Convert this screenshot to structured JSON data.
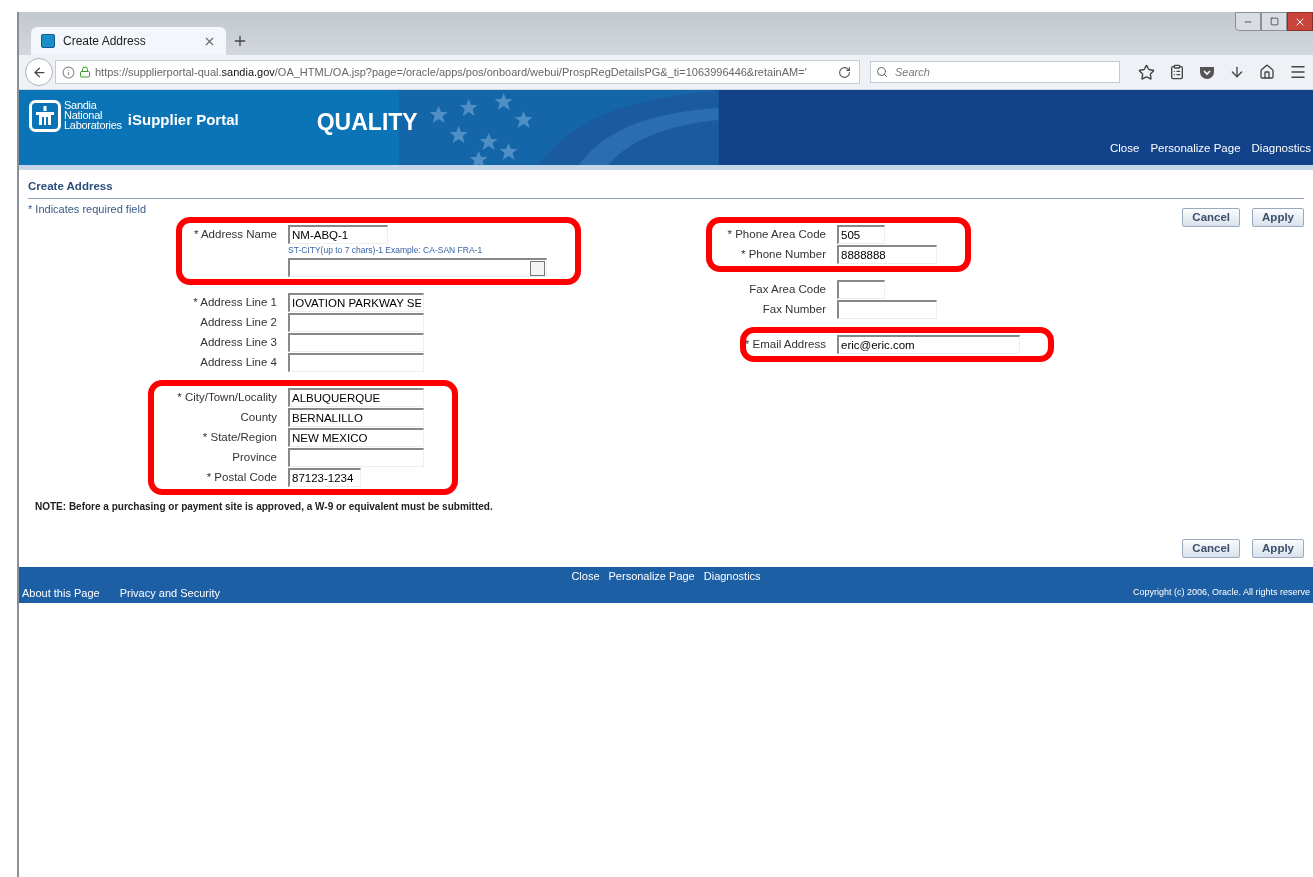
{
  "browser": {
    "tabs": [
      {
        "title": "Create Address",
        "selected": true
      }
    ],
    "url": {
      "prefix": "https://supplierportal-qual.",
      "domain": "sandia.gov",
      "path": "/OA_HTML/OA.jsp?page=/oracle/apps/pos/onboard/webui/ProspRegDetailsPG&_ti=1063996446&retainAM='"
    },
    "search": {
      "placeholder": "Search"
    }
  },
  "header": {
    "logo_lines": [
      "Sandia",
      "National",
      "Laboratories"
    ],
    "app_name": "iSupplier Portal",
    "environment": "QUALITY",
    "links": [
      "Close",
      "Personalize Page",
      "Diagnostics"
    ]
  },
  "page": {
    "title": "Create Address",
    "required_note": "* Indicates required field",
    "buttons": [
      "Cancel",
      "Apply"
    ],
    "left_groups": [
      {
        "highlighted": true,
        "fields": [
          {
            "label": "* Address Name",
            "value": "NM-ABQ-1",
            "kind": "short",
            "hint": "ST-CITY(up to 7 chars)-1 Example: CA-SAN FRA-1"
          },
          {
            "kind": "lookup"
          }
        ]
      },
      {
        "highlighted": false,
        "fields": [
          {
            "label": "* Address Line 1",
            "value": "IOVATION PARKWAY SE",
            "kind": "medium"
          },
          {
            "label": "Address Line 2",
            "kind": "medium"
          },
          {
            "label": "Address Line 3",
            "kind": "medium"
          },
          {
            "label": "Address Line 4",
            "kind": "medium"
          }
        ]
      },
      {
        "highlighted": true,
        "fields": [
          {
            "label": "* City/Town/Locality",
            "value": "ALBUQUERQUE",
            "kind": "medium"
          },
          {
            "label": "County",
            "value": "BERNALILLO",
            "kind": "medium"
          },
          {
            "label": "* State/Region",
            "value": "NEW MEXICO",
            "kind": "medium"
          },
          {
            "label": "Province",
            "kind": "medium"
          },
          {
            "label": "* Postal Code",
            "value": "87123-1234",
            "kind": "postal"
          }
        ]
      }
    ],
    "right_groups": [
      {
        "highlighted": true,
        "fields": [
          {
            "label": "* Phone Area Code",
            "value": "505",
            "kind": "tiny"
          },
          {
            "label": "* Phone Number",
            "value": "8888888",
            "kind": "short"
          }
        ]
      },
      {
        "highlighted": false,
        "fields": [
          {
            "label": "Fax Area Code",
            "kind": "tiny"
          },
          {
            "label": "Fax Number",
            "kind": "short"
          }
        ]
      },
      {
        "highlighted": true,
        "fields": [
          {
            "label": "* Email Address",
            "value": "eric@eric.com",
            "kind": "long"
          }
        ]
      }
    ],
    "note": "NOTE: Before a purchasing or payment site is approved, a W-9 or equivalent must be submitted.",
    "bottom_buttons": [
      "Cancel",
      "Apply"
    ]
  },
  "footer": {
    "center_links": [
      "Close",
      "Personalize Page",
      "Diagnostics"
    ],
    "left_links": [
      "About this Page",
      "Privacy and Security"
    ],
    "copyright": "Copyright (c) 2006, Oracle. All rights reserve"
  }
}
